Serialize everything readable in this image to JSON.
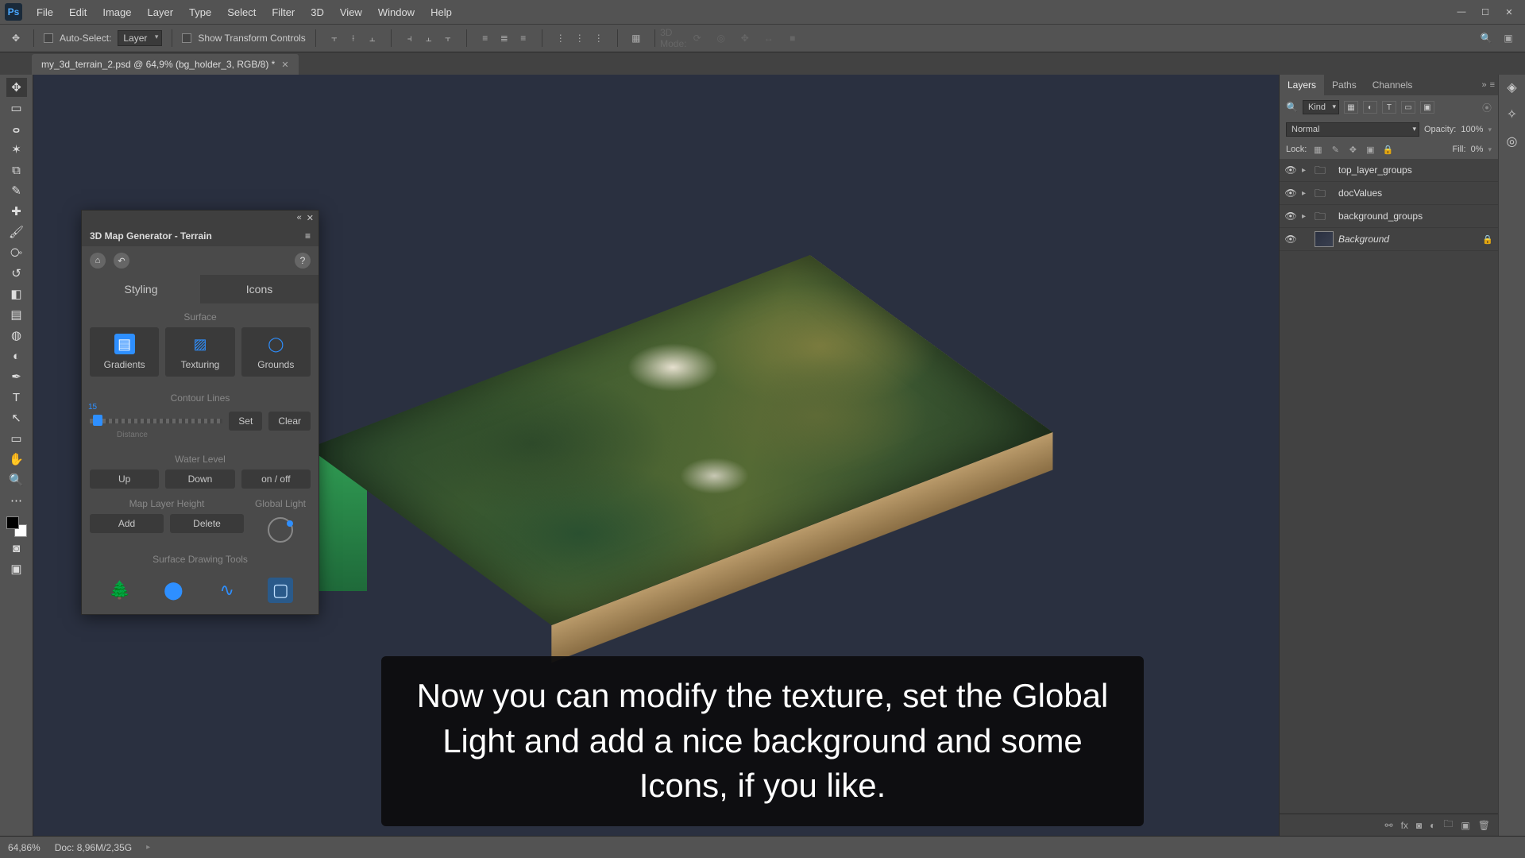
{
  "app": {
    "logo": "Ps"
  },
  "menu": [
    "File",
    "Edit",
    "Image",
    "Layer",
    "Type",
    "Select",
    "Filter",
    "3D",
    "View",
    "Window",
    "Help"
  ],
  "options": {
    "auto_select": "Auto-Select:",
    "layer_dd": "Layer",
    "show_transform": "Show Transform Controls",
    "mode_3d": "3D Mode:"
  },
  "tab": {
    "title": "my_3d_terrain_2.psd @ 64,9% (bg_holder_3, RGB/8) *"
  },
  "map_panel": {
    "title": "3D Map Generator - Terrain",
    "tabs": {
      "styling": "Styling",
      "icons": "Icons"
    },
    "surface_label": "Surface",
    "tiles": {
      "gradients": "Gradients",
      "texturing": "Texturing",
      "grounds": "Grounds"
    },
    "contour_label": "Contour Lines",
    "contour_value": "15",
    "distance_label": "Distance",
    "set": "Set",
    "clear": "Clear",
    "water_label": "Water Level",
    "up": "Up",
    "down": "Down",
    "onoff": "on / off",
    "height_label": "Map Layer Height",
    "light_label": "Global Light",
    "add": "Add",
    "delete": "Delete",
    "draw_label": "Surface Drawing Tools"
  },
  "layers_panel": {
    "tabs": [
      "Layers",
      "Paths",
      "Channels"
    ],
    "kind": "Kind",
    "blend": "Normal",
    "opacity_label": "Opacity:",
    "opacity": "100%",
    "lock_label": "Lock:",
    "fill_label": "Fill:",
    "fill": "0%",
    "layers": [
      {
        "name": "top_layer_groups",
        "type": "folder"
      },
      {
        "name": "docValues",
        "type": "folder"
      },
      {
        "name": "background_groups",
        "type": "folder"
      },
      {
        "name": "Background",
        "type": "bg",
        "locked": true
      }
    ]
  },
  "status": {
    "zoom": "64,86%",
    "doc": "Doc: 8,96M/2,35G"
  },
  "subtitle": "Now you can modify the texture, set the Global Light and add a nice background and some Icons, if you like."
}
